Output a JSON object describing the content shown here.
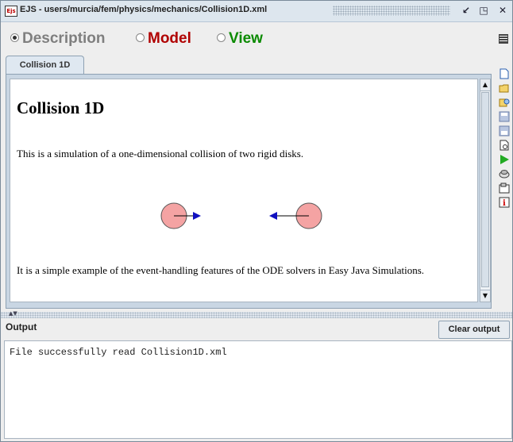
{
  "window": {
    "title": "EJS - users/murcia/fem/physics/mechanics/Collision1D.xml",
    "logo_text": "Ejs"
  },
  "modes": [
    {
      "label": "Description",
      "selected": true,
      "color": "#7f7f7f"
    },
    {
      "label": "Model",
      "selected": false,
      "color": "#b00000"
    },
    {
      "label": "View",
      "selected": false,
      "color": "#0a8a00"
    }
  ],
  "tab": {
    "label": "Collision 1D"
  },
  "description": {
    "heading": "Collision 1D",
    "paragraph1": "This is a simulation of a one-dimensional collision of two rigid disks.",
    "paragraph2": "It is a simple example of the event-handling features of the ODE solvers in Easy Java Simulations."
  },
  "toolbar": {
    "icons": [
      "new-file-icon",
      "open-folder-icon",
      "search-examples-icon",
      "save-icon",
      "save-as-icon",
      "search-icon",
      "run-icon",
      "package-icon",
      "preferences-icon",
      "info-icon"
    ]
  },
  "output": {
    "title": "Output",
    "clear_label": "Clear output",
    "lines": [
      "File successfully read Collision1D.xml"
    ]
  },
  "colors": {
    "disk_fill": "#f4a3a3",
    "arrow": "#1010c0",
    "accent_view": "#0a8a00",
    "accent_model": "#b00000"
  }
}
